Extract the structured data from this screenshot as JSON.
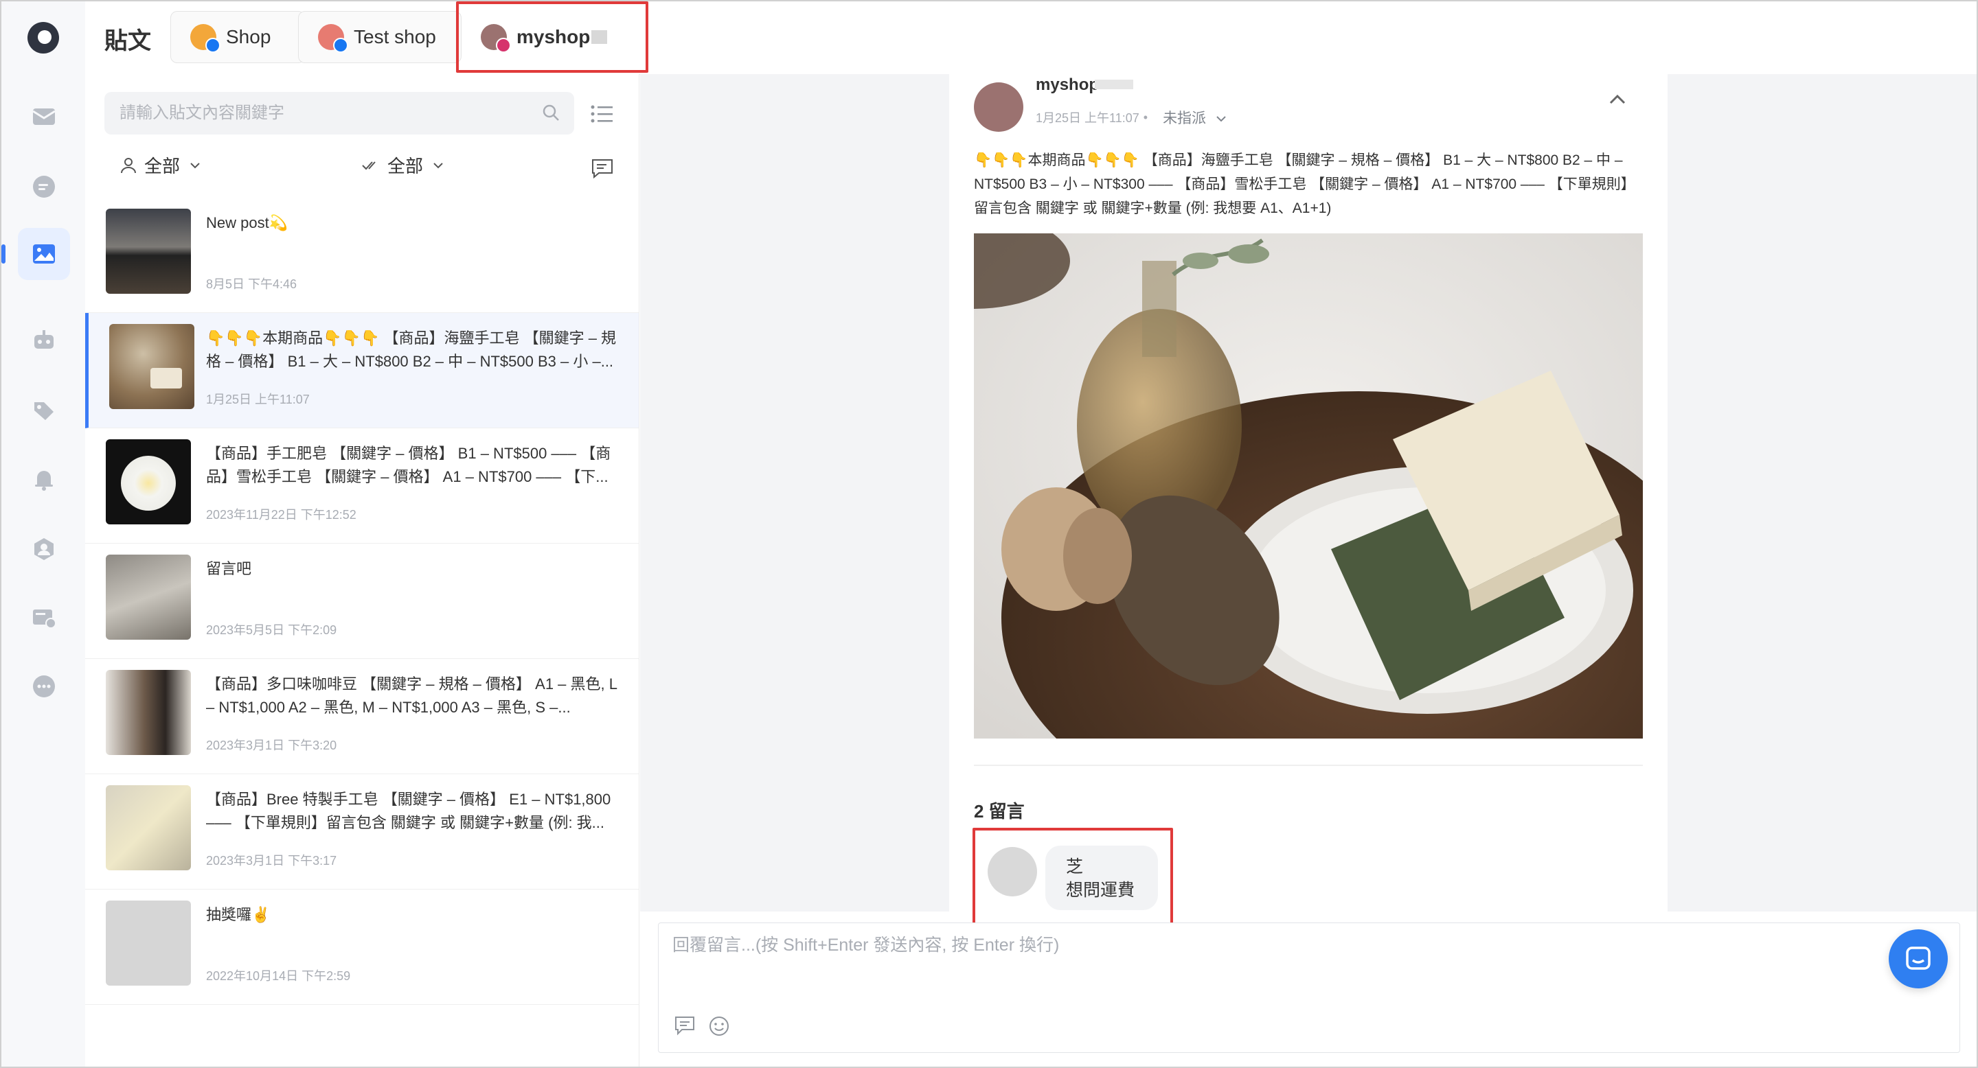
{
  "topbar": {
    "title": "貼文",
    "tabs": [
      {
        "label": "Shop",
        "channel": "facebook-icon"
      },
      {
        "label": "Test shop",
        "channel": "facebook-icon"
      },
      {
        "label": "myshop",
        "channel": "instagram-icon",
        "selected": true
      }
    ]
  },
  "rail": {
    "items": [
      "inbox-icon",
      "chat-icon",
      "posts-icon",
      "bot-icon",
      "tag-icon",
      "bell-icon",
      "contacts-icon",
      "broadcast-icon",
      "more-icon"
    ],
    "active": "posts-icon"
  },
  "posts_panel": {
    "search_placeholder": "請輸入貼文內容關鍵字",
    "filter_assignee": "全部",
    "filter_status": "全部",
    "posts": [
      {
        "text": "New post💫",
        "date": "8月5日 下午4:46"
      },
      {
        "text": "👇👇👇本期商品👇👇👇 【商品】海鹽手工皂 【關鍵字 – 規格 – 價格】 B1 – 大 – NT$800 B2 – 中 – NT$500 B3 – 小 –...",
        "date": "1月25日 上午11:07",
        "selected": true
      },
      {
        "text": "【商品】手工肥皂 【關鍵字 – 價格】 B1 – NT$500 ––– 【商品】雪松手工皂 【關鍵字 – 價格】 A1 – NT$700 ––– 【下...",
        "date": "2023年11月22日 下午12:52"
      },
      {
        "text": "留言吧",
        "date": "2023年5月5日 下午2:09"
      },
      {
        "text": "【商品】多口味咖啡豆 【關鍵字 – 規格 – 價格】 A1 – 黑色, L – NT$1,000 A2 – 黑色, M – NT$1,000 A3 – 黑色, S –...",
        "date": "2023年3月1日 下午3:20"
      },
      {
        "text": "【商品】Bree 特製手工皂 【關鍵字 – 價格】 E1 – NT$1,800 ––– 【下單規則】留言包含 關鍵字 或 關鍵字+數量 (例: 我...",
        "date": "2023年3月1日 下午3:17"
      },
      {
        "text": "抽獎囉✌️",
        "date": "2022年10月14日 下午2:59"
      }
    ]
  },
  "detail": {
    "author": "myshop",
    "time": "1月25日 上午11:07",
    "separator": "•",
    "assign": "未指派",
    "caption": "👇👇👇本期商品👇👇👇 【商品】海鹽手工皂 【關鍵字 – 規格 – 價格】 B1 – 大 – NT$800 B2 – 中 – NT$500 B3 – 小 – NT$300 ––– 【商品】雪松手工皂 【關鍵字 – 價格】 A1 – NT$700 ––– 【下單規則】留言包含 關鍵字 或 關鍵字+數量 (例: 我想要 A1、A1+1)",
    "comment_count": "2 留言",
    "comments": [
      {
        "author": "芝",
        "text": "想問運費"
      }
    ]
  },
  "reply": {
    "placeholder": "回覆留言...(按 Shift+Enter 發送內容, 按 Enter 換行)"
  },
  "colors": {
    "accent": "#3b7bf6",
    "highlight": "#e03a3a",
    "fab": "#2f7ff1"
  }
}
